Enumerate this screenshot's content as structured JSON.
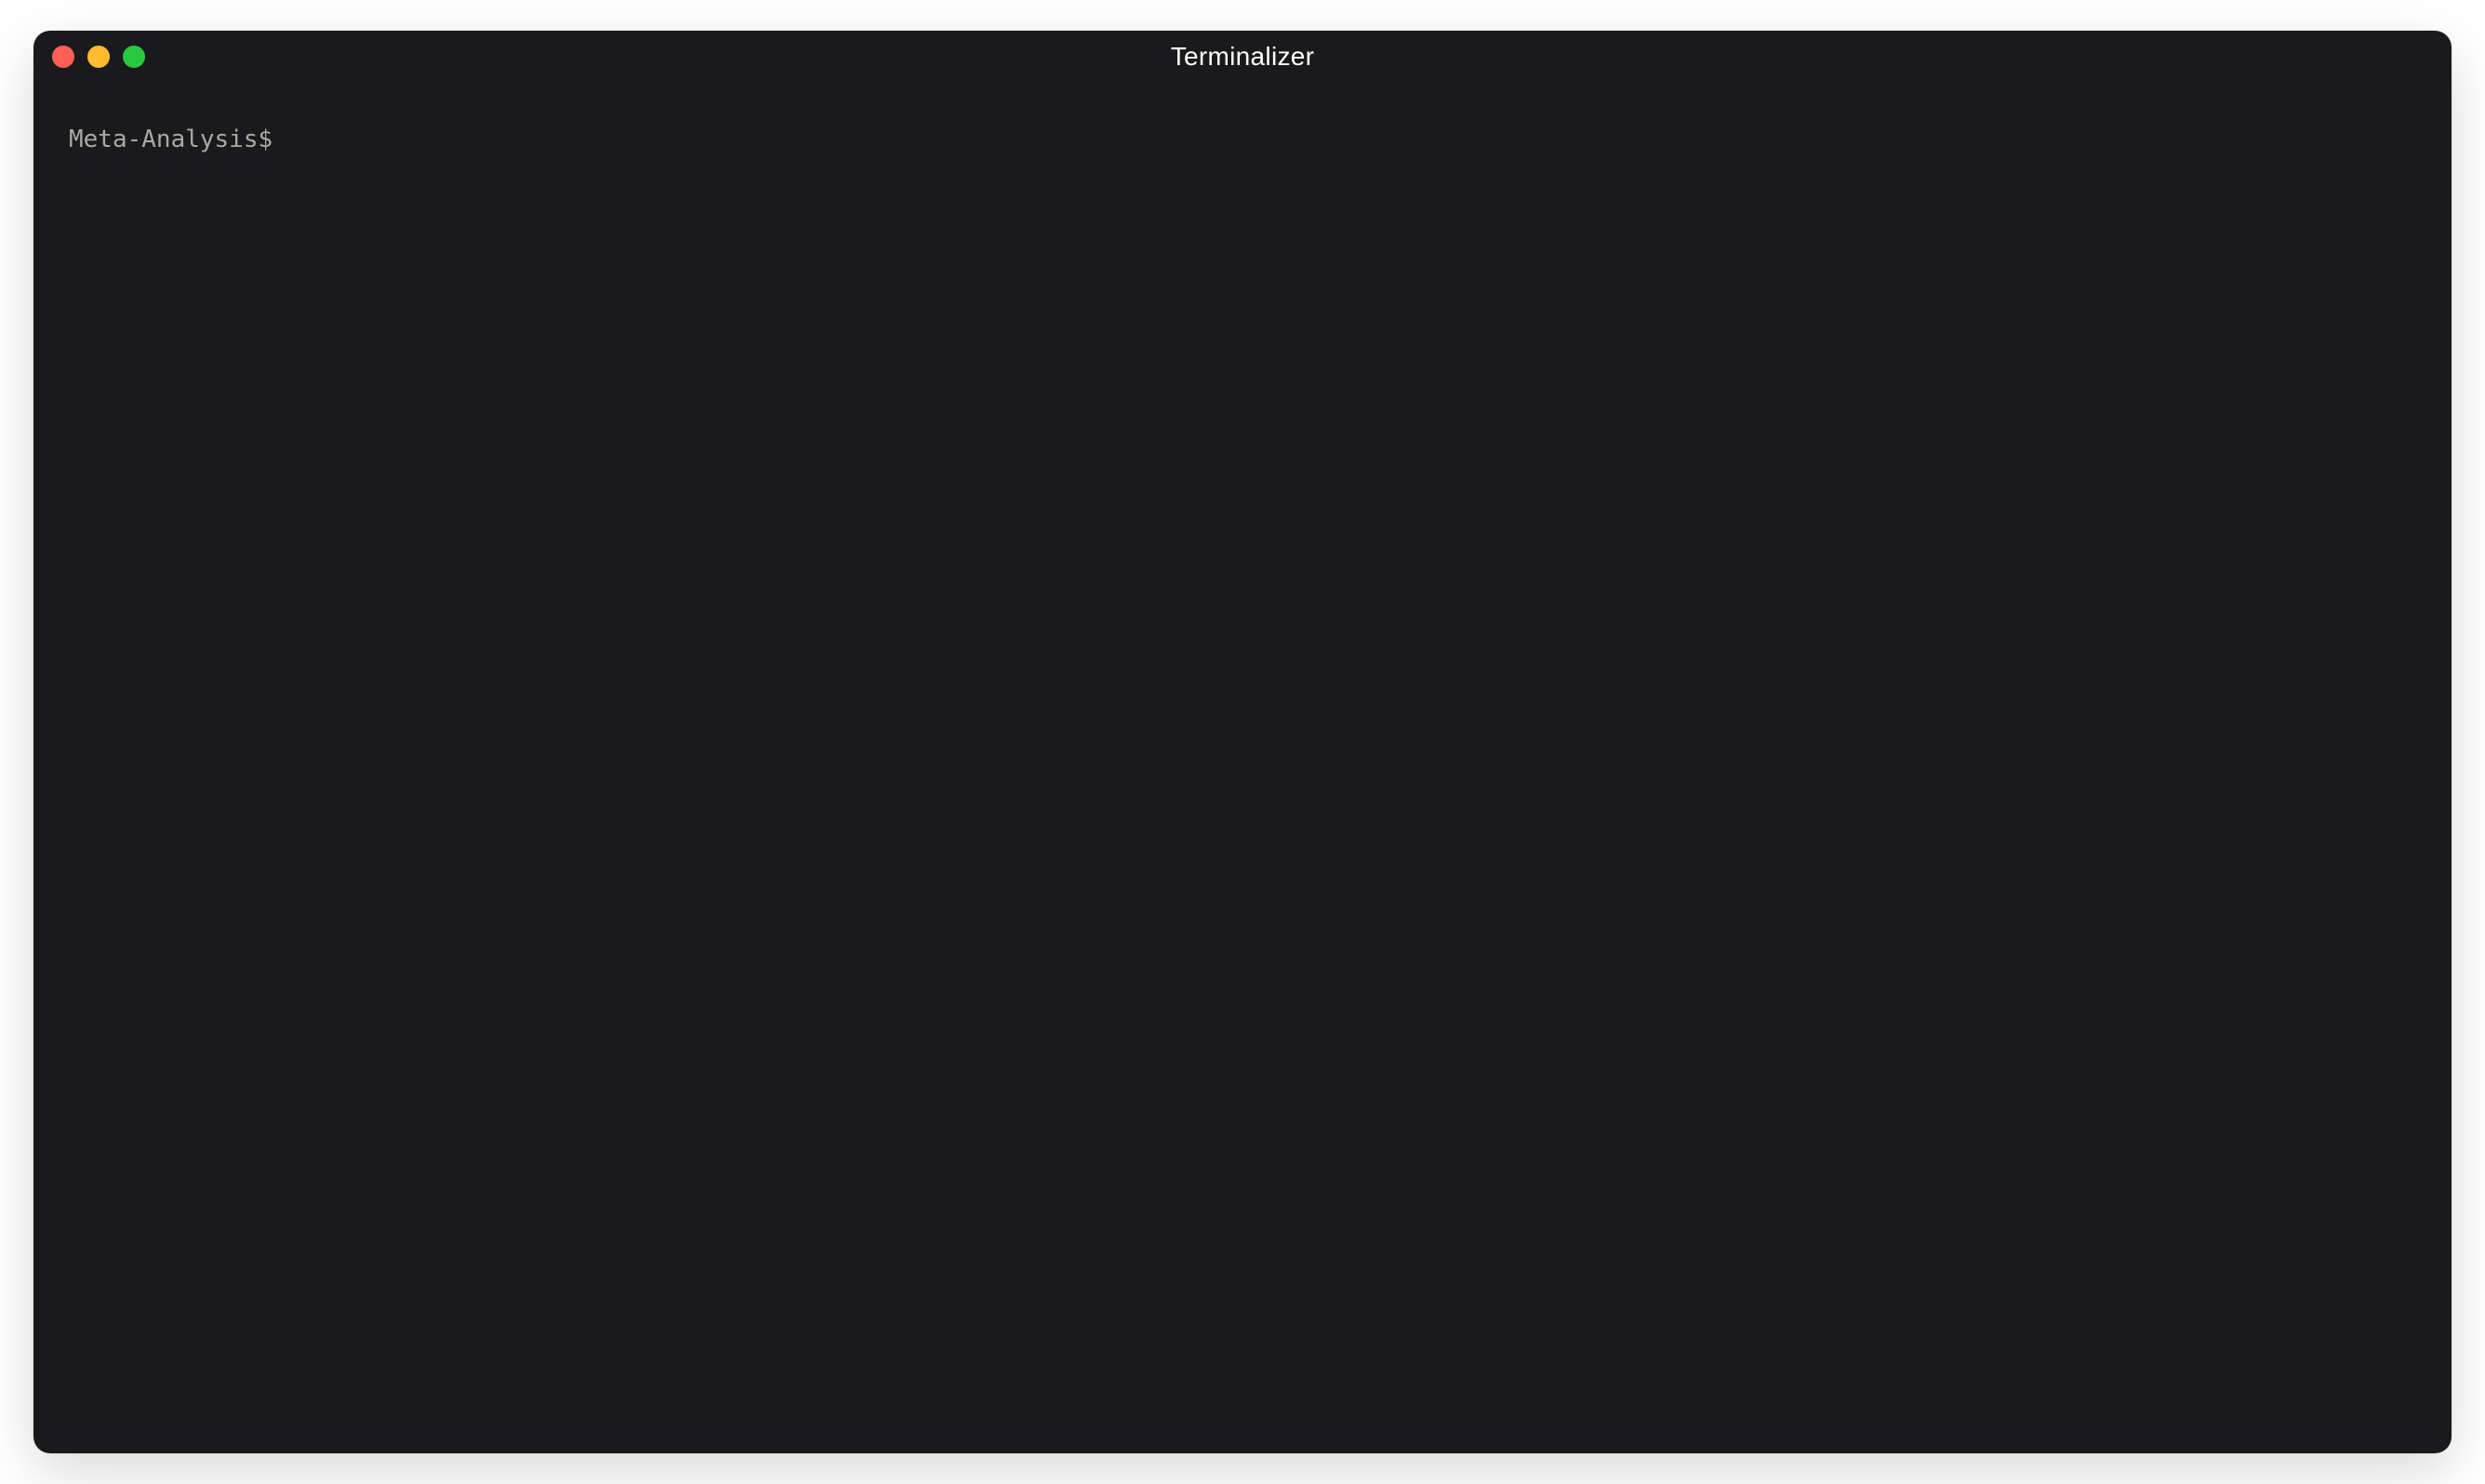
{
  "window": {
    "title": "Terminalizer"
  },
  "terminal": {
    "prompt": "Meta-Analysis$ ",
    "current_input": ""
  }
}
